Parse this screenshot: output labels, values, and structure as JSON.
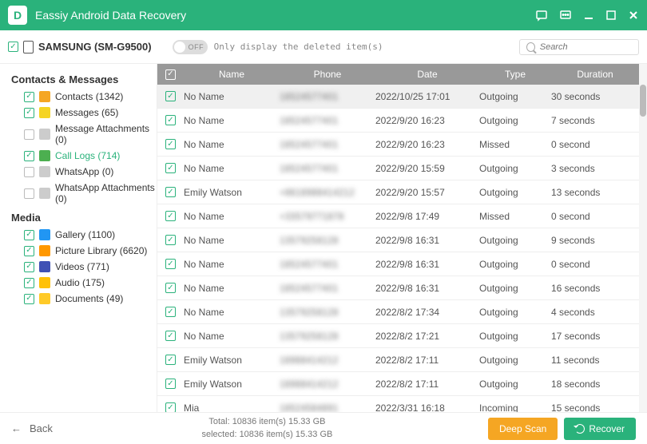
{
  "app_title": "Eassiy Android Data Recovery",
  "device": "SAMSUNG (SM-G9500)",
  "toggle_text": "OFF",
  "toggle_label": "Only display the deleted item(s)",
  "search_placeholder": "Search",
  "categories": [
    {
      "title": "Contacts & Messages",
      "items": [
        {
          "label": "Contacts (1342)",
          "icon_bg": "#f5a623",
          "checked": true
        },
        {
          "label": "Messages (65)",
          "icon_bg": "#f5d423",
          "checked": true
        },
        {
          "label": "Message Attachments (0)",
          "icon_bg": "#ccc",
          "checked": false,
          "gray": true
        },
        {
          "label": "Call Logs (714)",
          "icon_bg": "#4caf50",
          "checked": true,
          "active": true
        },
        {
          "label": "WhatsApp (0)",
          "icon_bg": "#ccc",
          "checked": false,
          "gray": true
        },
        {
          "label": "WhatsApp Attachments (0)",
          "icon_bg": "#ccc",
          "checked": false,
          "gray": true
        }
      ]
    },
    {
      "title": "Media",
      "items": [
        {
          "label": "Gallery (1100)",
          "icon_bg": "#2196f3",
          "checked": true
        },
        {
          "label": "Picture Library (6620)",
          "icon_bg": "#ff9800",
          "checked": true
        },
        {
          "label": "Videos (771)",
          "icon_bg": "#3f51b5",
          "checked": true
        },
        {
          "label": "Audio (175)",
          "icon_bg": "#ffc107",
          "checked": true
        },
        {
          "label": "Documents (49)",
          "icon_bg": "#ffca28",
          "checked": true
        }
      ]
    }
  ],
  "columns": {
    "name": "Name",
    "phone": "Phone",
    "date": "Date",
    "type": "Type",
    "duration": "Duration"
  },
  "rows": [
    {
      "name": "No Name",
      "phone": "18524577401",
      "date": "2022/10/25 17:01",
      "type": "Outgoing",
      "duration": "30 seconds",
      "selected": true
    },
    {
      "name": "No Name",
      "phone": "18524577401",
      "date": "2022/9/20 16:23",
      "type": "Outgoing",
      "duration": "7 seconds"
    },
    {
      "name": "No Name",
      "phone": "18524577401",
      "date": "2022/9/20 16:23",
      "type": "Missed",
      "duration": "0 second"
    },
    {
      "name": "No Name",
      "phone": "18524577401",
      "date": "2022/9/20 15:59",
      "type": "Outgoing",
      "duration": "3 seconds"
    },
    {
      "name": "Emily Watson",
      "phone": "+8618988414212",
      "date": "2022/9/20 15:57",
      "type": "Outgoing",
      "duration": "13 seconds"
    },
    {
      "name": "No Name",
      "phone": "+33579771878",
      "date": "2022/9/8 17:49",
      "type": "Missed",
      "duration": "0 second"
    },
    {
      "name": "No Name",
      "phone": "13579258128",
      "date": "2022/9/8 16:31",
      "type": "Outgoing",
      "duration": "9 seconds"
    },
    {
      "name": "No Name",
      "phone": "18524577401",
      "date": "2022/9/8 16:31",
      "type": "Outgoing",
      "duration": "0 second"
    },
    {
      "name": "No Name",
      "phone": "18524577401",
      "date": "2022/9/8 16:31",
      "type": "Outgoing",
      "duration": "16 seconds"
    },
    {
      "name": "No Name",
      "phone": "13579258128",
      "date": "2022/8/2 17:34",
      "type": "Outgoing",
      "duration": "4 seconds"
    },
    {
      "name": "No Name",
      "phone": "13579258128",
      "date": "2022/8/2 17:21",
      "type": "Outgoing",
      "duration": "17 seconds"
    },
    {
      "name": "Emily Watson",
      "phone": "18988414212",
      "date": "2022/8/2 17:11",
      "type": "Outgoing",
      "duration": "11 seconds"
    },
    {
      "name": "Emily Watson",
      "phone": "18988414212",
      "date": "2022/8/2 17:11",
      "type": "Outgoing",
      "duration": "18 seconds"
    },
    {
      "name": "Mia",
      "phone": "18524584891",
      "date": "2022/3/31 16:18",
      "type": "Incoming",
      "duration": "15 seconds"
    }
  ],
  "footer": {
    "back": "Back",
    "total_line": "Total: 10836 item(s) 15.33 GB",
    "selected_line": "selected: 10836 item(s) 15.33 GB",
    "deep_scan": "Deep Scan",
    "recover": "Recover"
  }
}
